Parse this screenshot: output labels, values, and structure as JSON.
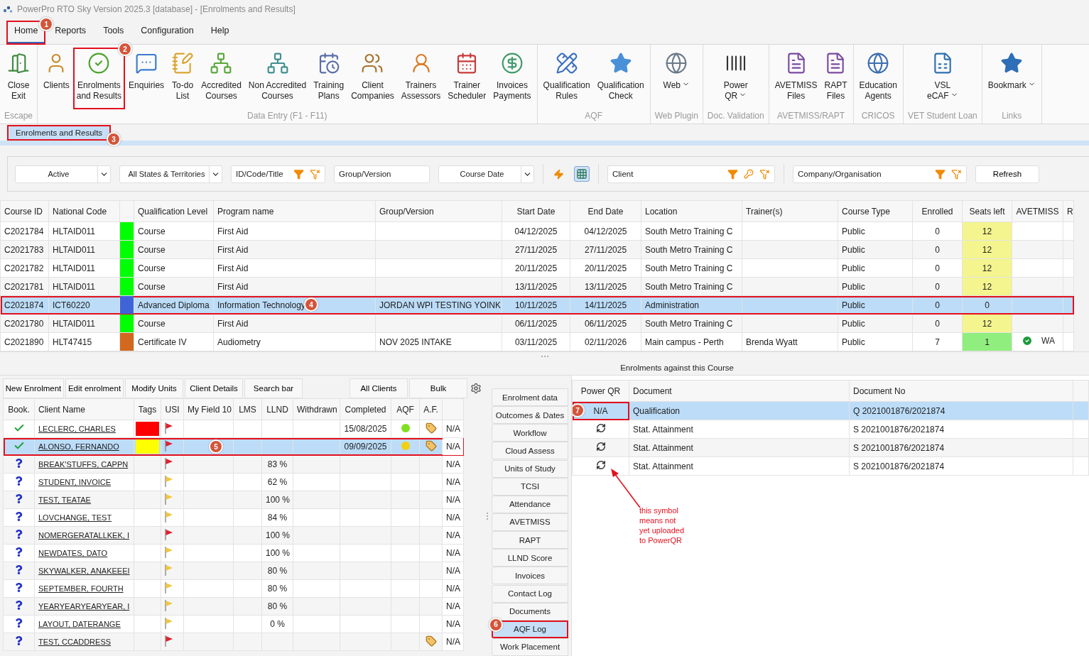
{
  "window": {
    "title": "PowerPro RTO Sky Version 2025.3 [database] - [Enrolments and Results]"
  },
  "menu": [
    {
      "label": "Home",
      "selected": true,
      "callout": "1"
    },
    {
      "label": "Reports",
      "selected": false
    },
    {
      "label": "Tools",
      "selected": false
    },
    {
      "label": "Configuration",
      "selected": false
    },
    {
      "label": "Help",
      "selected": false
    }
  ],
  "ribbon": [
    {
      "label": "Escape",
      "items": [
        {
          "lines": [
            "Close",
            "Exit"
          ],
          "dropdown": false
        }
      ]
    },
    {
      "label": "Data Entry (F1 - F11)",
      "items": [
        {
          "lines": [
            "Clients"
          ],
          "dropdown": false
        },
        {
          "lines": [
            "Enrolments",
            "and Results"
          ],
          "dropdown": false,
          "callout": "2"
        },
        {
          "lines": [
            "Enquiries"
          ],
          "dropdown": false
        },
        {
          "lines": [
            "To-do",
            "List"
          ],
          "dropdown": false
        },
        {
          "lines": [
            "Accredited",
            "Courses"
          ],
          "dropdown": false
        },
        {
          "lines": [
            "Non Accredited",
            "Courses"
          ],
          "dropdown": false
        },
        {
          "lines": [
            "Training",
            "Plans"
          ],
          "dropdown": false
        },
        {
          "lines": [
            "Client",
            "Companies"
          ],
          "dropdown": false
        },
        {
          "lines": [
            "Trainers",
            "Assessors"
          ],
          "dropdown": false
        },
        {
          "lines": [
            "Trainer",
            "Scheduler"
          ],
          "dropdown": false
        },
        {
          "lines": [
            "Invoices",
            "Payments"
          ],
          "dropdown": false
        }
      ]
    },
    {
      "label": "AQF",
      "items": [
        {
          "lines": [
            "Qualification",
            "Rules"
          ],
          "dropdown": false
        },
        {
          "lines": [
            "Qualification",
            "Check"
          ],
          "dropdown": false
        }
      ]
    },
    {
      "label": "Web Plugin",
      "items": [
        {
          "lines": [
            "Web"
          ],
          "dropdown": true
        }
      ]
    },
    {
      "label": "Doc. Validation",
      "items": [
        {
          "lines": [
            "Power",
            "QR"
          ],
          "dropdown": true
        }
      ]
    },
    {
      "label": "AVETMISS/RAPT",
      "items": [
        {
          "lines": [
            "AVETMISS",
            "Files"
          ],
          "dropdown": false
        },
        {
          "lines": [
            "RAPT",
            "Files"
          ],
          "dropdown": false
        }
      ]
    },
    {
      "label": "CRICOS",
      "items": [
        {
          "lines": [
            "Education",
            "Agents"
          ],
          "dropdown": false
        }
      ]
    },
    {
      "label": "VET Student Loan",
      "items": [
        {
          "lines": [
            "VSL",
            "eCAF"
          ],
          "dropdown": true
        }
      ]
    },
    {
      "label": "Links",
      "items": [
        {
          "lines": [
            "Bookmark"
          ],
          "dropdown": true
        }
      ]
    }
  ],
  "document_tab": {
    "label": "Enrolments and Results",
    "callout": "3"
  },
  "filters": [
    {
      "kind": "select",
      "value": "Active"
    },
    {
      "kind": "select",
      "value": "All States & Territories"
    },
    {
      "kind": "search",
      "placeholder": "ID/Code/Title",
      "key_button": false
    },
    {
      "kind": "field",
      "placeholder": "Group/Version"
    },
    {
      "kind": "select",
      "value": "Course Date"
    },
    {
      "kind": "lightning"
    },
    {
      "kind": "toggle",
      "on": true
    },
    {
      "kind": "search",
      "placeholder": "Client",
      "key_button": true
    },
    {
      "kind": "search",
      "placeholder": "Company/Organisation",
      "key_button": false
    },
    {
      "kind": "button",
      "label": "Refresh"
    }
  ],
  "course_table": {
    "columns": [
      "Course ID",
      "National Code",
      "",
      "Qualification Level",
      "Program name",
      "Group/Version",
      "Start Date",
      "End Date",
      "Location",
      "Trainer(s)",
      "Course Type",
      "Enrolled",
      "Seats left",
      "AVETMISS",
      "R"
    ],
    "rows": [
      {
        "id": "C2021784",
        "code": "HLTAID011",
        "color": "#00ff00",
        "level": "Course",
        "program": "First Aid",
        "start": "04/12/2025",
        "end": "04/12/2025",
        "location": "South Metro Training C",
        "type": "Public",
        "enrolled": "0",
        "seats": {
          "text": "12",
          "color": "#f4f58e"
        },
        "avetmiss_verified": false,
        "selected": false
      },
      {
        "id": "C2021783",
        "code": "HLTAID011",
        "color": "#00ff00",
        "level": "Course",
        "program": "First Aid",
        "start": "27/11/2025",
        "end": "27/11/2025",
        "location": "South Metro Training C",
        "type": "Public",
        "enrolled": "0",
        "seats": {
          "text": "12",
          "color": "#f4f58e"
        },
        "avetmiss_verified": false,
        "selected": false
      },
      {
        "id": "C2021782",
        "code": "HLTAID011",
        "color": "#00ff00",
        "level": "Course",
        "program": "First Aid",
        "start": "20/11/2025",
        "end": "20/11/2025",
        "location": "South Metro Training C",
        "type": "Public",
        "enrolled": "0",
        "seats": {
          "text": "12",
          "color": "#f4f58e"
        },
        "avetmiss_verified": false,
        "selected": false
      },
      {
        "id": "C2021781",
        "code": "HLTAID011",
        "color": "#00ff00",
        "level": "Course",
        "program": "First Aid",
        "start": "13/11/2025",
        "end": "13/11/2025",
        "location": "South Metro Training C",
        "type": "Public",
        "enrolled": "0",
        "seats": {
          "text": "12",
          "color": "#f4f58e"
        },
        "avetmiss_verified": false,
        "selected": false
      },
      {
        "id": "C2021874",
        "code": "ICT60220",
        "color": "#3e64d8",
        "level": "Advanced Diploma",
        "program": "Information Technology",
        "group": "JORDAN WPI TESTING YOINK",
        "start": "10/11/2025",
        "end": "14/11/2025",
        "location": "Administration",
        "type": "Public",
        "enrolled": "0",
        "seats": {
          "text": "0"
        },
        "avetmiss_verified": false,
        "selected": true,
        "callout": "4"
      },
      {
        "id": "C2021780",
        "code": "HLTAID011",
        "color": "#00ff00",
        "level": "Course",
        "program": "First Aid",
        "start": "06/11/2025",
        "end": "06/11/2025",
        "location": "South Metro Training C",
        "type": "Public",
        "enrolled": "0",
        "seats": {
          "text": "12",
          "color": "#f4f58e"
        },
        "avetmiss_verified": false,
        "selected": false
      },
      {
        "id": "C2021890",
        "code": "HLT47415",
        "color": "#d2691e",
        "level": "Certificate IV",
        "program": "Audiometry",
        "group": "NOV 2025 INTAKE",
        "start": "03/11/2025",
        "end": "02/11/2026",
        "location": "Main campus - Perth",
        "trainer": "Brenda Wyatt",
        "type": "Public",
        "enrolled": "7",
        "seats": {
          "text": "1",
          "color": "#90ee7e"
        },
        "avetmiss_verified": true,
        "avetmiss": "WA",
        "selected": false
      }
    ]
  },
  "enrolments_caption": "Enrolments against this Course",
  "enrolment_toolbar": {
    "left": [
      "New Enrolment",
      "Edit enrolment",
      "Modify Units",
      "Client Details",
      "Search bar"
    ],
    "right": [
      "All Clients",
      "Bulk"
    ]
  },
  "enrolment_table": {
    "columns": [
      "Book.",
      "Client Name",
      "Tags",
      "USI",
      "My Field 10",
      "LMS",
      "LLND",
      "Withdrawn",
      "Completed",
      "AQF",
      "A.F."
    ],
    "rows": [
      {
        "booked": true,
        "name": "LECLERC, CHARLES",
        "tag": {
          "color": "#ff0000"
        },
        "flag": {
          "color": "#e02030"
        },
        "completed": "15/08/2025",
        "aqf": {
          "color": "#7ee01e"
        },
        "af_tag": true,
        "column_12": "N/A",
        "selected": false
      },
      {
        "booked": true,
        "name": "ALONSO, FERNANDO",
        "tag": {
          "color": "#ffff00"
        },
        "flag": {
          "color": "#e02030"
        },
        "completed": "09/09/2025",
        "aqf": {
          "color": "#f0d010"
        },
        "af_tag": true,
        "column_12": "N/A",
        "selected": true,
        "callout": "5"
      },
      {
        "booked": false,
        "name": "BREAK'STUFFS, CAPPN",
        "flag": {
          "color": "#e02030"
        },
        "llnd": "83 %",
        "af_tag": false,
        "column_12": "N/A",
        "selected": false
      },
      {
        "booked": false,
        "name": "STUDENT, INVOICE",
        "flag": {
          "color": "#f0c840"
        },
        "llnd": "62 %",
        "af_tag": false,
        "column_12": "N/A",
        "selected": false
      },
      {
        "booked": false,
        "name": "TEST, TEATAE",
        "flag": {
          "color": "#f0c840"
        },
        "llnd": "100 %",
        "af_tag": false,
        "column_12": "N/A",
        "selected": false
      },
      {
        "booked": false,
        "name": "LOVCHANGE, TEST",
        "flag": {
          "color": "#f0c840"
        },
        "llnd": "84 %",
        "af_tag": false,
        "column_12": "N/A",
        "selected": false
      },
      {
        "booked": false,
        "name": "NOMERGERATALLKEK, I",
        "flag": {
          "color": "#e02030"
        },
        "llnd": "100 %",
        "af_tag": false,
        "column_12": "N/A",
        "selected": false
      },
      {
        "booked": false,
        "name": "NEWDATES, DATO",
        "flag": {
          "color": "#f0c840"
        },
        "llnd": "100 %",
        "af_tag": false,
        "column_12": "N/A",
        "selected": false
      },
      {
        "booked": false,
        "name": "SKYWALKER, ANAKEEEI",
        "flag": {
          "color": "#f0c840"
        },
        "llnd": "80 %",
        "af_tag": false,
        "column_12": "N/A",
        "selected": false
      },
      {
        "booked": false,
        "name": "SEPTEMBER, FOURTH",
        "flag": {
          "color": "#f0c840"
        },
        "llnd": "80 %",
        "af_tag": false,
        "column_12": "N/A",
        "selected": false
      },
      {
        "booked": false,
        "name": "YEARYEARYEARYEAR, I",
        "flag": {
          "color": "#f0c840"
        },
        "llnd": "80 %",
        "af_tag": false,
        "column_12": "N/A",
        "selected": false
      },
      {
        "booked": false,
        "name": "LAYOUT, DATERANGE",
        "flag": {
          "color": "#f0c840"
        },
        "llnd": "0 %",
        "af_tag": false,
        "column_12": "N/A",
        "selected": false
      },
      {
        "booked": false,
        "name": "TEST, CCADDRESS",
        "flag": {
          "color": "#e02030"
        },
        "af_tag": true,
        "column_12": "N/A",
        "selected": false
      }
    ]
  },
  "side_tabs": [
    {
      "label": "Enrolment data",
      "selected": false
    },
    {
      "label": "Outcomes & Dates",
      "selected": false
    },
    {
      "label": "Workflow",
      "selected": false
    },
    {
      "label": "Cloud Assess",
      "selected": false
    },
    {
      "label": "Units of Study",
      "selected": false
    },
    {
      "label": "TCSI",
      "selected": false
    },
    {
      "label": "Attendance",
      "selected": false
    },
    {
      "label": "AVETMISS",
      "selected": false
    },
    {
      "label": "RAPT",
      "selected": false
    },
    {
      "label": "LLND Score",
      "selected": false
    },
    {
      "label": "Invoices",
      "selected": false
    },
    {
      "label": "Contact Log",
      "selected": false
    },
    {
      "label": "Documents",
      "selected": false
    },
    {
      "label": "AQF Log",
      "selected": true,
      "callout": "6"
    },
    {
      "label": "Work Placement",
      "selected": false
    }
  ],
  "documents_table": {
    "columns": [
      "Power QR",
      "Document",
      "Document No"
    ],
    "rows": [
      {
        "kind": "text",
        "power_qr": "N/A",
        "callout": "7",
        "document": "Qualification",
        "document_no": "Q 2021001876/2021874",
        "selected": true
      },
      {
        "kind": "sync",
        "document": "Stat. Attainment",
        "document_no": "S 2021001876/2021874",
        "selected": false
      },
      {
        "kind": "sync",
        "document": "Stat. Attainment",
        "document_no": "S 2021001876/2021874",
        "selected": false
      },
      {
        "kind": "sync",
        "document": "Stat. Attainment",
        "document_no": "S 2021001876/2021874",
        "selected": false
      }
    ]
  },
  "annotation_note": [
    "this symbol",
    "means not",
    "yet uploaded",
    "to PowerQR"
  ]
}
